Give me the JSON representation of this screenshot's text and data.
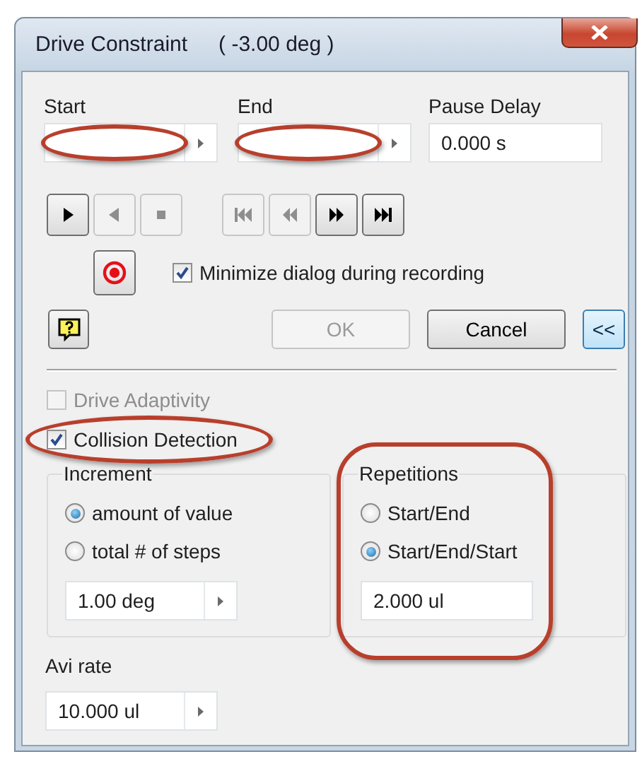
{
  "window": {
    "title": "Drive Constraint",
    "reading": "( -3.00 deg )"
  },
  "fields": [
    {
      "label": "Start",
      "kind": "spinner",
      "highlighted": true
    },
    {
      "label": "End",
      "kind": "spinner",
      "highlighted": true
    },
    {
      "label": "Pause Delay",
      "kind": "plain",
      "value": "0.000 s"
    }
  ],
  "transport_groups": [
    {
      "buttons": [
        {
          "kind": "play",
          "disabled": false
        },
        {
          "kind": "reverse",
          "disabled": true
        },
        {
          "kind": "stop",
          "disabled": true
        }
      ]
    },
    {
      "buttons": [
        {
          "kind": "skip-start",
          "disabled": true
        },
        {
          "kind": "rewind",
          "disabled": true
        },
        {
          "kind": "fast-forward",
          "disabled": false
        },
        {
          "kind": "skip-end",
          "disabled": false
        }
      ]
    }
  ],
  "minimize_option": {
    "label": "Minimize dialog during recording",
    "checked": true
  },
  "buttons": [
    {
      "label": "OK",
      "disabled": true,
      "focused": false
    },
    {
      "label": "Cancel",
      "disabled": false,
      "focused": false
    },
    {
      "label": "<<",
      "disabled": false,
      "focused": true
    }
  ],
  "options": [
    {
      "label": "Drive Adaptivity",
      "checked": false,
      "disabled": true
    },
    {
      "label": "Collision Detection",
      "checked": true,
      "disabled": false,
      "highlighted": true
    }
  ],
  "increment": {
    "label": "Increment",
    "options": [
      {
        "label": "amount of value",
        "selected": true
      },
      {
        "label": "total # of steps",
        "selected": false
      }
    ],
    "value": "1.00 deg"
  },
  "repetitions": {
    "label": "Repetitions",
    "highlighted": true,
    "options": [
      {
        "label": "Start/End",
        "selected": false
      },
      {
        "label": "Start/End/Start",
        "selected": true
      }
    ],
    "value": "2.000 ul"
  },
  "avi_rate": {
    "label": "Avi rate",
    "value": "10.000 ul"
  }
}
